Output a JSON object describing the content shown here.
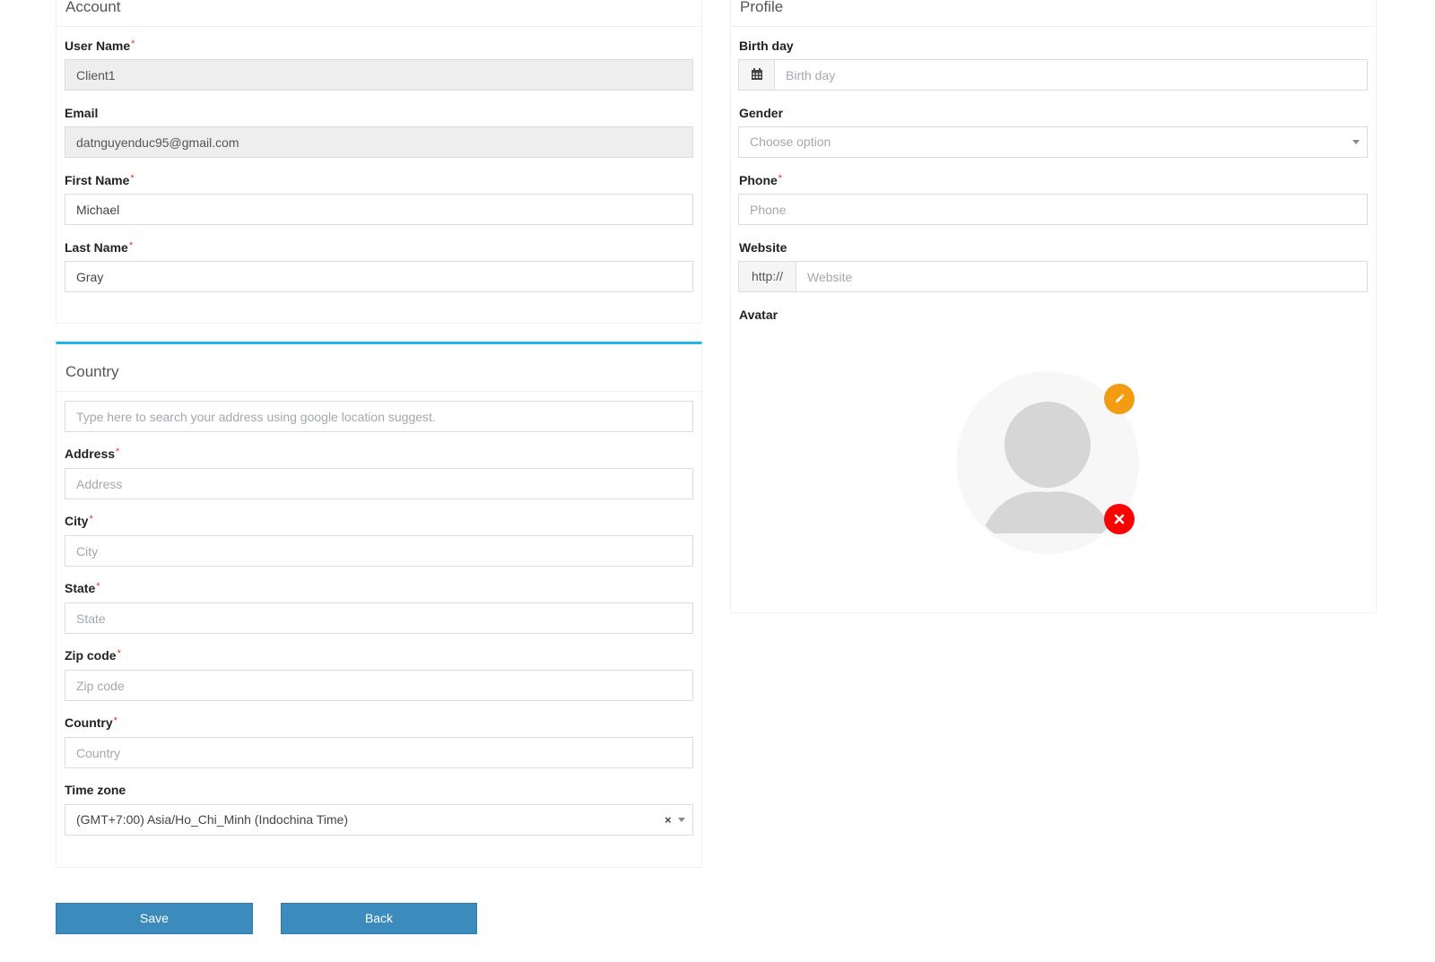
{
  "account": {
    "title": "Account",
    "username": {
      "label": "User Name",
      "value": "Client1"
    },
    "email": {
      "label": "Email",
      "value": "datnguyenduc95@gmail.com"
    },
    "first_name": {
      "label": "First Name",
      "value": "Michael"
    },
    "last_name": {
      "label": "Last Name",
      "value": "Gray"
    }
  },
  "country_section": {
    "title": "Country",
    "search": {
      "placeholder": "Type here to search your address using google location suggest."
    },
    "address": {
      "label": "Address",
      "placeholder": "Address"
    },
    "city": {
      "label": "City",
      "placeholder": "City"
    },
    "state": {
      "label": "State",
      "placeholder": "State"
    },
    "zip": {
      "label": "Zip code",
      "placeholder": "Zip code"
    },
    "country": {
      "label": "Country",
      "placeholder": "Country"
    },
    "timezone": {
      "label": "Time zone",
      "value": "(GMT+7:00) Asia/Ho_Chi_Minh (Indochina Time)",
      "clear": "×"
    }
  },
  "profile": {
    "title": "Profile",
    "birthday": {
      "label": "Birth day",
      "placeholder": "Birth day"
    },
    "gender": {
      "label": "Gender",
      "placeholder": "Choose option"
    },
    "phone": {
      "label": "Phone",
      "placeholder": "Phone"
    },
    "website": {
      "label": "Website",
      "prefix": "http://",
      "placeholder": "Website"
    },
    "avatar": {
      "label": "Avatar"
    }
  },
  "required_mark": "*",
  "actions": {
    "save": "Save",
    "back": "Back"
  },
  "colors": {
    "accent": "#1fb5e8",
    "button": "#3b8bbd",
    "edit": "#f39c12",
    "remove": "#ff0000",
    "required": "#e2322b"
  },
  "icons": {
    "calendar": "calendar-icon",
    "edit": "pencil-icon",
    "remove": "close-icon"
  }
}
